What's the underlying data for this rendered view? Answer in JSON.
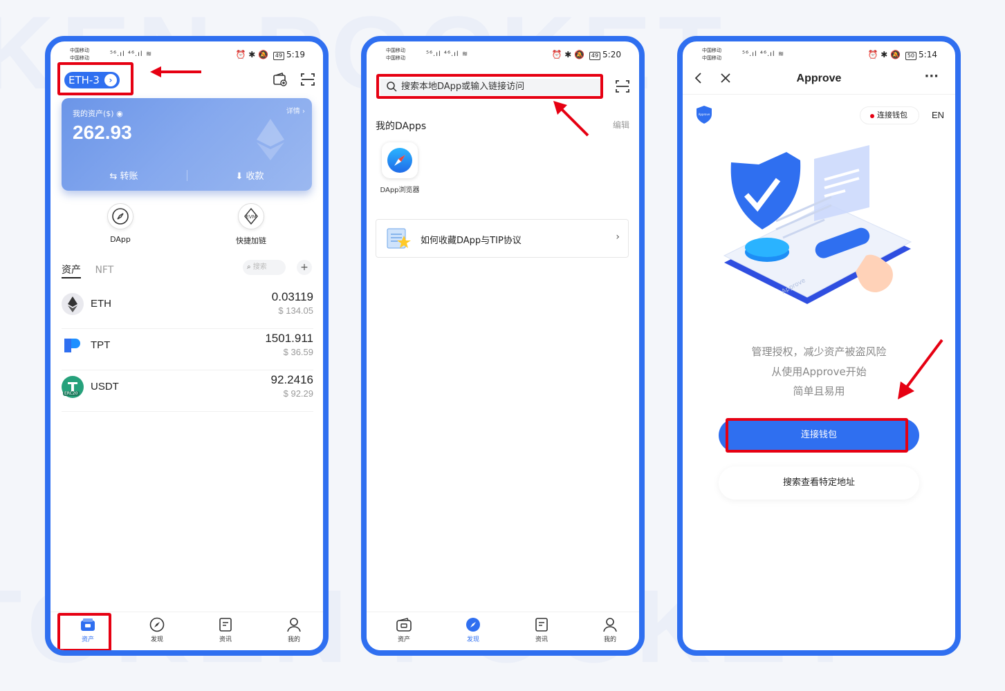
{
  "watermark": [
    "KEN POCKET",
    "TOKEN POCKET"
  ],
  "colors": {
    "accent": "#2f6ff0",
    "highlight": "#e60012"
  },
  "phone1": {
    "status": {
      "carrier1": "中国移动",
      "carrier2": "中国移动",
      "signal": "⁵⁶.ıl ⁴⁶.ıl ≋",
      "icons": "⏰ ✱ 🔕",
      "battery": "49",
      "time": "5:19"
    },
    "network": "ETH-3",
    "wallet_card": {
      "label": "我的资产($)",
      "detail": "详情 ›",
      "total": "262.93",
      "transfer": "⇆ 转账",
      "receive": "⬇ 收款"
    },
    "quick": [
      {
        "label": "DApp",
        "icon": "compass-icon"
      },
      {
        "label": "快捷加链",
        "icon": "evm-icon"
      }
    ],
    "tabs": {
      "assets": "资产",
      "nft": "NFT",
      "search": "搜索"
    },
    "assets": [
      {
        "symbol": "ETH",
        "amount": "0.03119",
        "usd": "$ 134.05"
      },
      {
        "symbol": "TPT",
        "amount": "1501.911",
        "usd": "$ 36.59"
      },
      {
        "symbol": "USDT",
        "amount": "92.2416",
        "usd": "$ 92.29",
        "badge": "ERC20"
      }
    ],
    "nav": [
      "资产",
      "发现",
      "资讯",
      "我的"
    ]
  },
  "phone2": {
    "status": {
      "carrier1": "中国移动",
      "carrier2": "中国移动",
      "signal": "⁵⁶.ıl ⁴⁶.ıl ≋",
      "icons": "⏰ ✱ 🔕",
      "battery": "49",
      "time": "5:20"
    },
    "search_placeholder": "搜索本地DApp或输入链接访问",
    "section_title": "我的DApps",
    "edit": "编辑",
    "dapp_tile": "DApp浏览器",
    "guide": "如何收藏DApp与TIP协议",
    "nav": [
      "资产",
      "发现",
      "资讯",
      "我的"
    ]
  },
  "phone3": {
    "status": {
      "carrier1": "中国移动",
      "carrier2": "中国移动",
      "signal": "⁵⁶.ıl ⁴⁶.ıl ≋",
      "icons": "⏰ ✱ 🔕",
      "battery": "50",
      "time": "5:14"
    },
    "title": "Approve",
    "more": "···",
    "connect_pill": "连接钱包",
    "lang": "EN",
    "tagline1": "管理授权，减少资产被盗风险",
    "tagline2": "从使用Approve开始",
    "tagline3": "简单且易用",
    "connect_button": "连接钱包",
    "search_button": "搜索查看特定地址",
    "illustration_word": "Approve",
    "logo_text": "Approve"
  }
}
